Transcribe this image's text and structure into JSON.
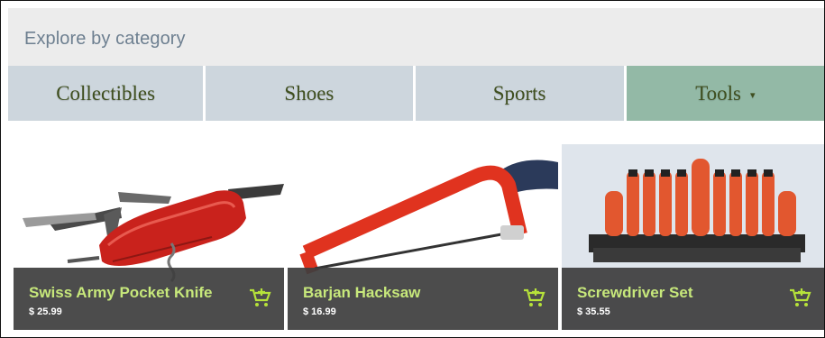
{
  "header": {
    "title": "Explore by category"
  },
  "tabs": [
    {
      "label": "Collectibles"
    },
    {
      "label": "Shoes"
    },
    {
      "label": "Sports"
    },
    {
      "label": "Tools",
      "caret": "▾"
    }
  ],
  "products": [
    {
      "name": "Swiss Army Pocket Knife",
      "price": "$ 25.99",
      "icon": "add-to-cart-icon"
    },
    {
      "name": "Barjan Hacksaw",
      "price": "$ 16.99",
      "icon": "add-to-cart-icon"
    },
    {
      "name": "Screwdriver Set",
      "price": "$ 35.55",
      "icon": "add-to-cart-icon"
    }
  ],
  "colors": {
    "header_bg": "#ececec",
    "tab_bg": "#cdd6dd",
    "tab_active_bg": "#93b9a6",
    "product_name": "#c7e87b",
    "overlay": "#3e3e3e"
  }
}
